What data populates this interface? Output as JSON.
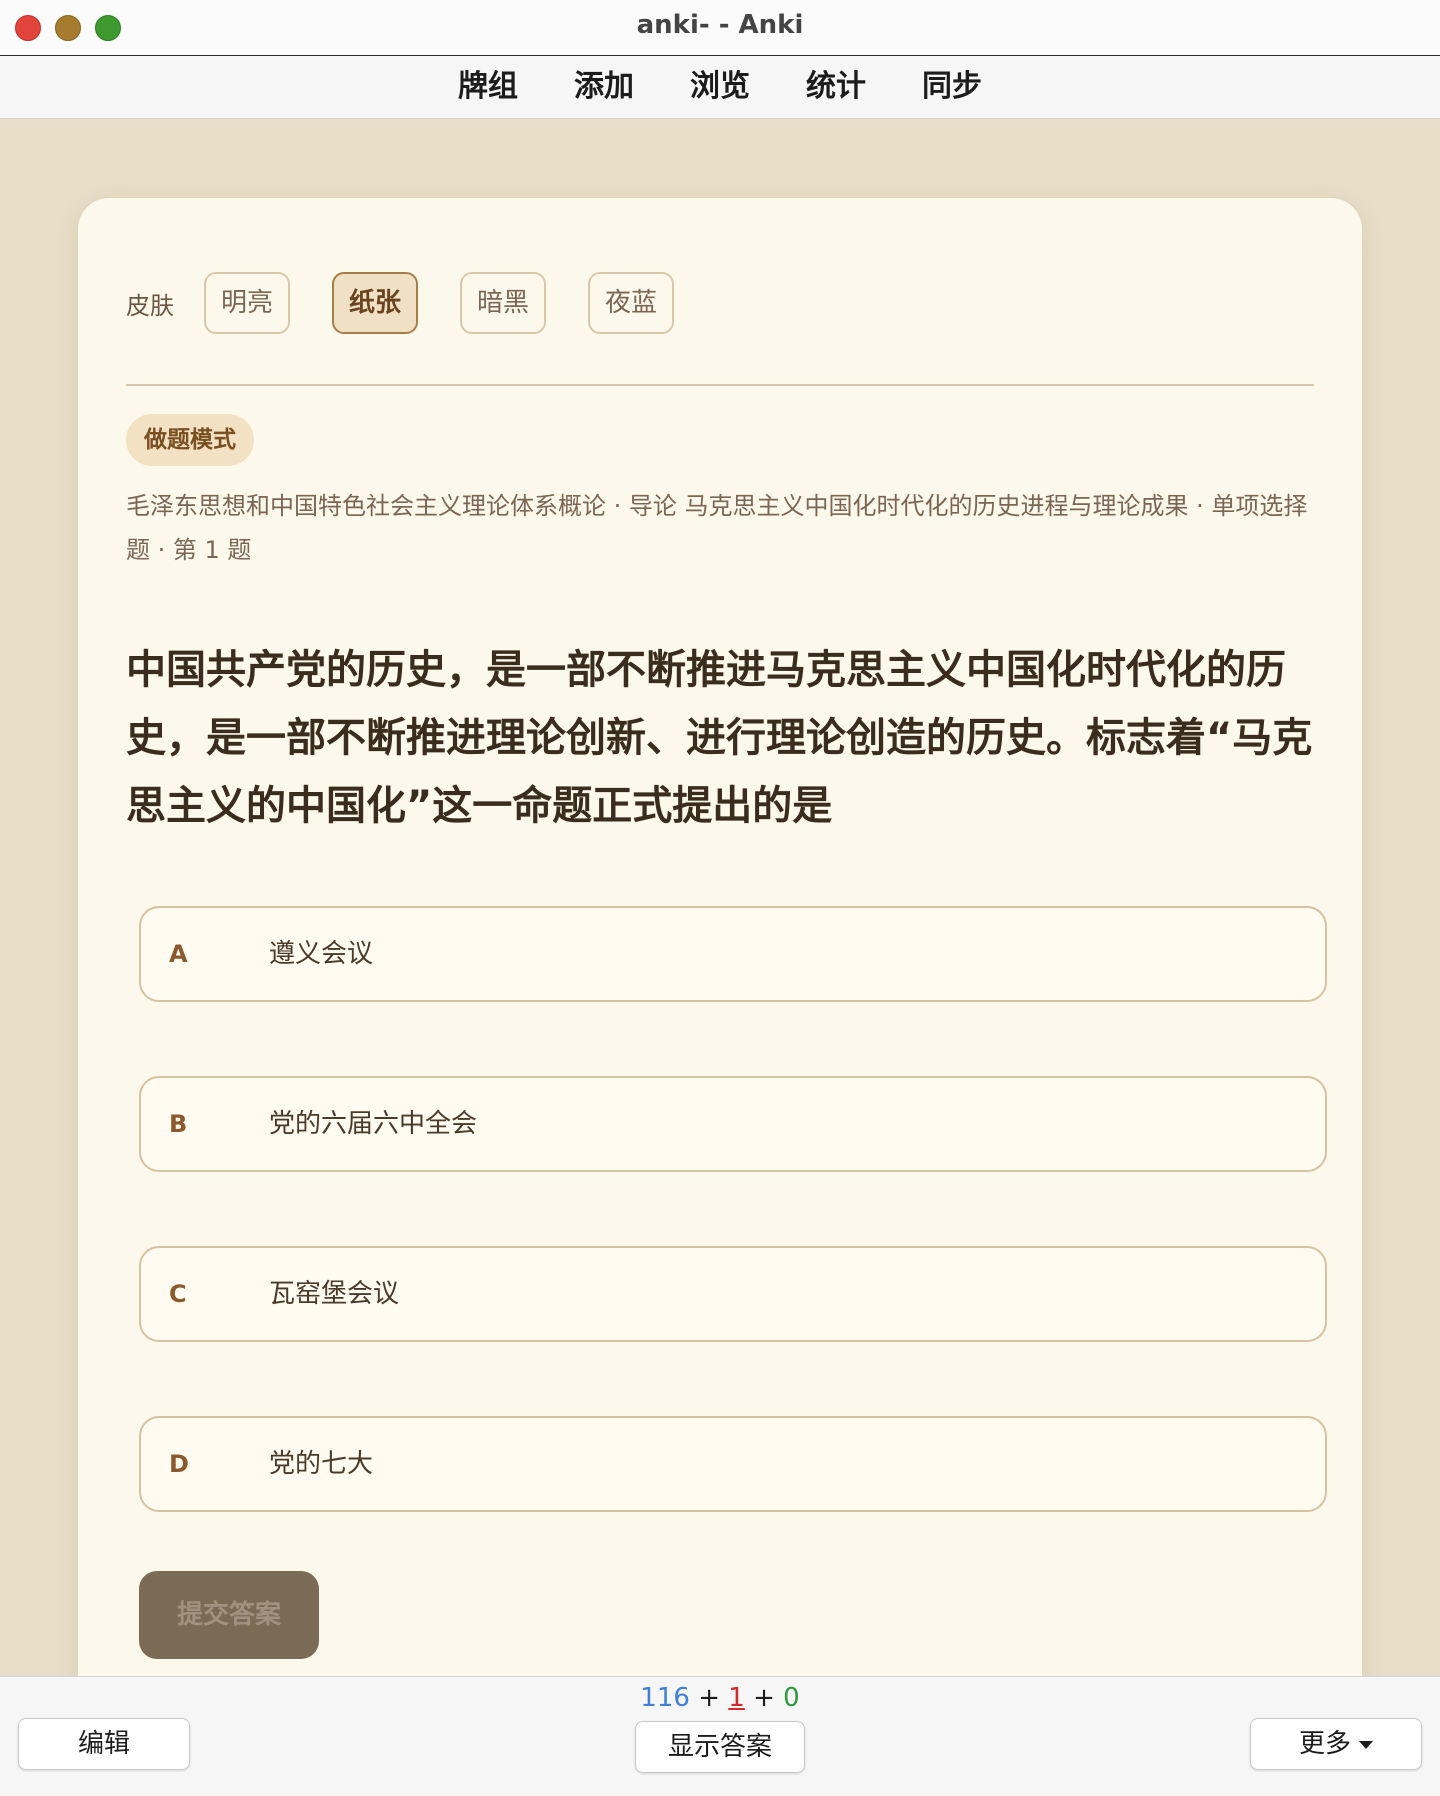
{
  "window": {
    "title": "anki- - Anki"
  },
  "menu": {
    "items": [
      "牌组",
      "添加",
      "浏览",
      "统计",
      "同步"
    ]
  },
  "card": {
    "skin_label": "皮肤",
    "skins": [
      "明亮",
      "纸张",
      "暗黑",
      "夜蓝"
    ],
    "active_skin": "纸张",
    "mode_badge": "做题模式",
    "meta": "毛泽东思想和中国特色社会主义理论体系概论 · 导论 马克思主义中国化时代化的历史进程与理论成果 · 单项选择题 · 第 1 题",
    "question": "中国共产党的历史，是一部不断推进马克思主义中国化时代化的历史，是一部不断推进理论创新、进行理论创造的历史。标志着“马克思主义的中国化”这一命题正式提出的是",
    "options": [
      {
        "letter": "A",
        "text": "遵义会议"
      },
      {
        "letter": "B",
        "text": "党的六届六中全会"
      },
      {
        "letter": "C",
        "text": "瓦窑堡会议"
      },
      {
        "letter": "D",
        "text": "党的七大"
      }
    ],
    "submit_label": "提交答案"
  },
  "bottom": {
    "edit_label": "编辑",
    "show_answer_label": "显示答案",
    "more_label": "更多",
    "counts": {
      "new": "116",
      "sep1": " + ",
      "learn": "1",
      "sep2": " + ",
      "review": "0"
    }
  },
  "colors": {
    "background": "#e8dec8",
    "card": "#fdf8ec",
    "accent": "#8a5a2e",
    "count_new": "#3f7fd6",
    "count_learn": "#d02a2a",
    "count_review": "#2e9a3a"
  }
}
